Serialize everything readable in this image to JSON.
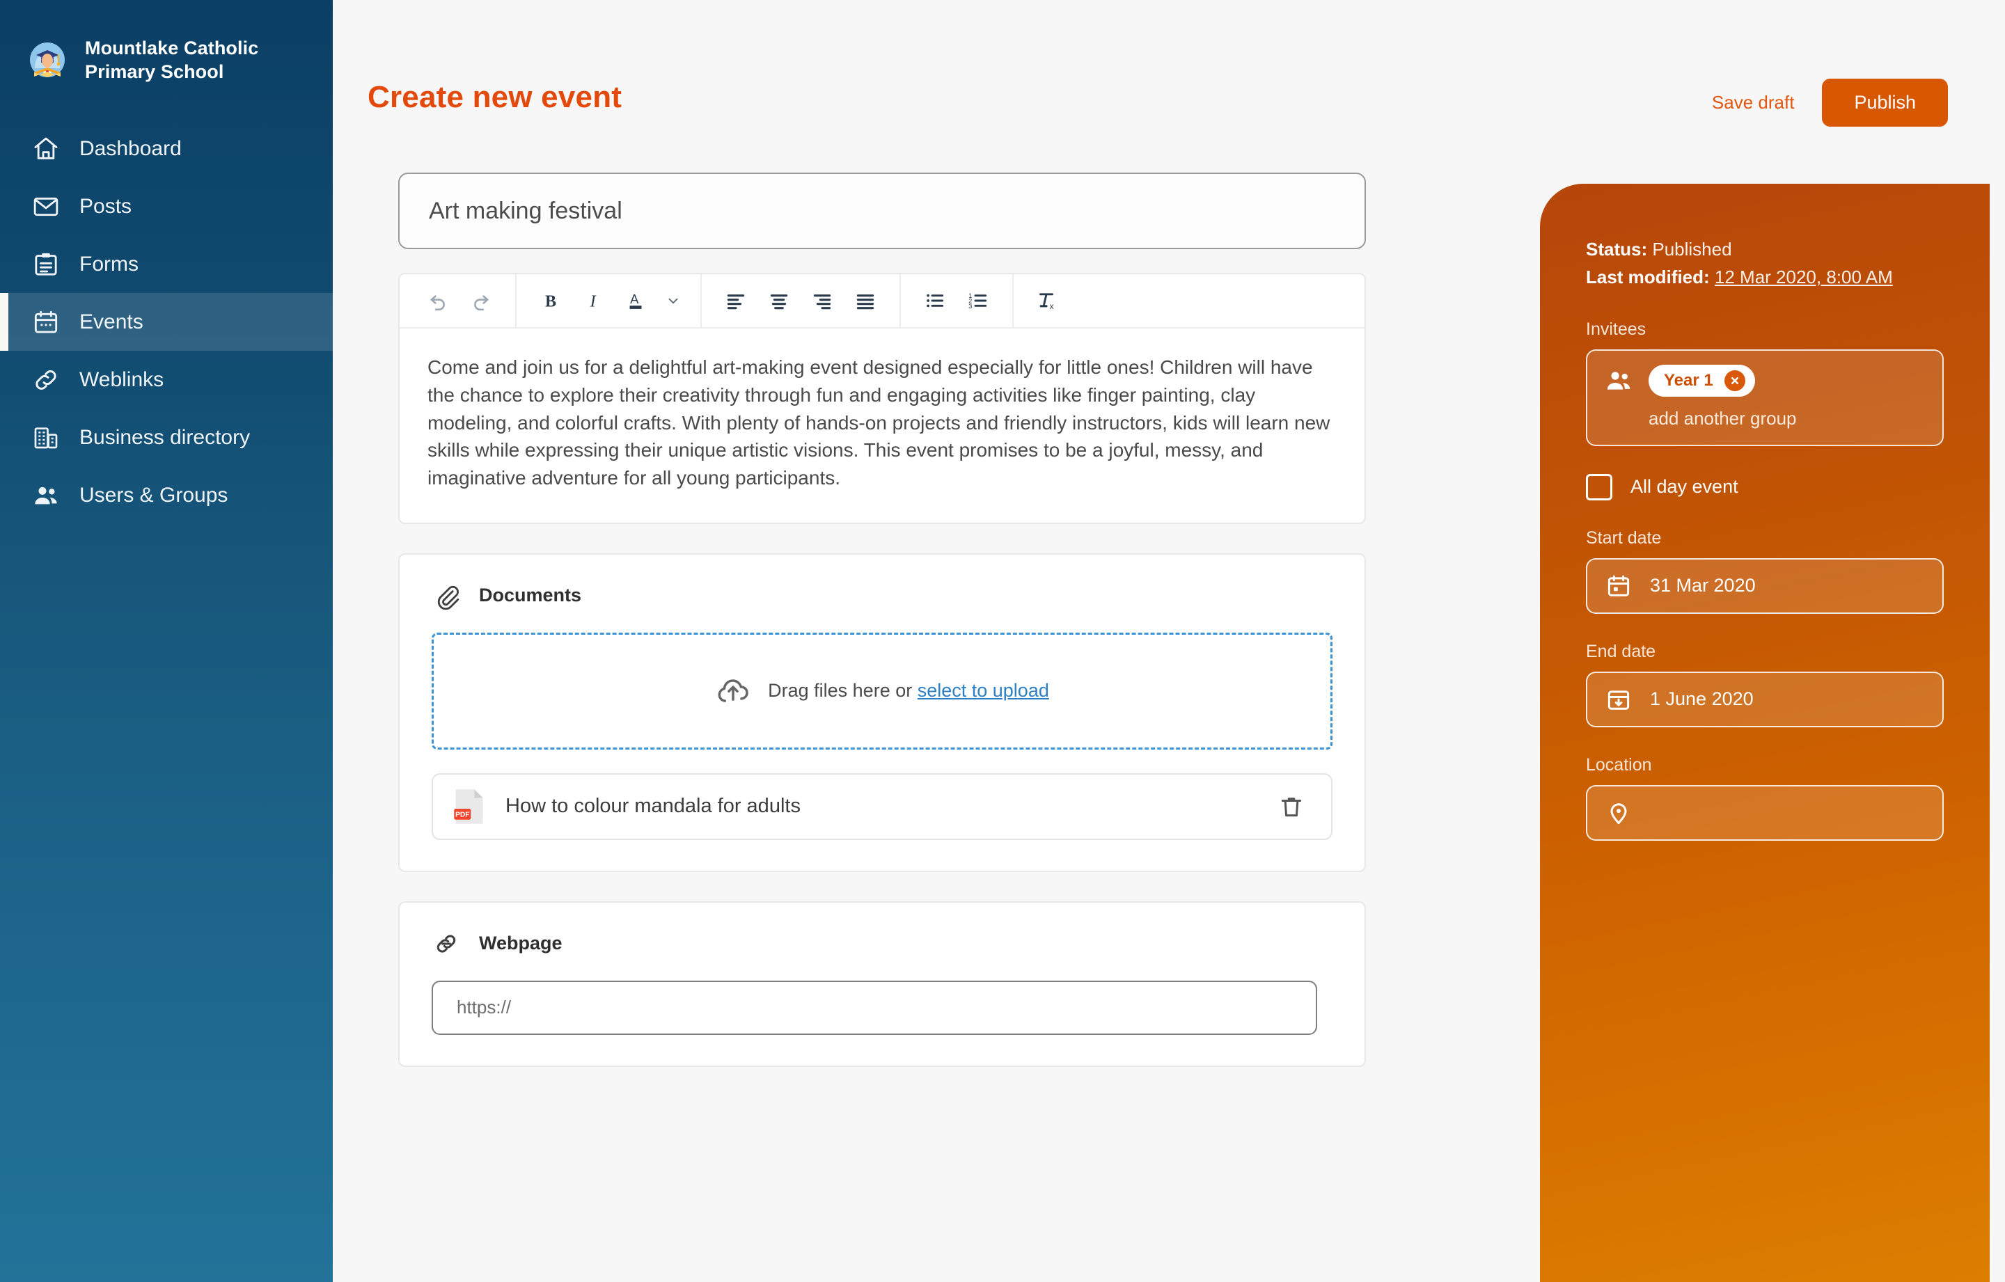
{
  "sidebar": {
    "school_name": "Mountlake Catholic\nPrimary School",
    "school_name_line1": "Mountlake Catholic",
    "school_name_line2": "Primary School",
    "items": [
      {
        "label": "Dashboard",
        "icon": "home-icon",
        "active": false
      },
      {
        "label": "Posts",
        "icon": "envelope-icon",
        "active": false
      },
      {
        "label": "Forms",
        "icon": "clipboard-icon",
        "active": false
      },
      {
        "label": "Events",
        "icon": "calendar-icon",
        "active": true
      },
      {
        "label": "Weblinks",
        "icon": "link-icon",
        "active": false
      },
      {
        "label": "Business directory",
        "icon": "building-icon",
        "active": false
      },
      {
        "label": "Users & Groups",
        "icon": "people-icon",
        "active": false
      }
    ]
  },
  "header": {
    "title": "Create new event",
    "save_draft_label": "Save draft",
    "publish_label": "Publish",
    "accent_color": "#e2490a",
    "publish_bg": "#d85703"
  },
  "event": {
    "title_value": "Art making festival",
    "title_placeholder": "Event title",
    "description": "Come and join us for a delightful art-making event designed especially for little ones! Children will have the chance to explore their creativity through fun and engaging activities like finger painting, clay modeling, and colorful crafts. With plenty of hands-on projects and friendly instructors, kids will learn new skills while expressing their unique artistic visions. This event promises to be a joyful, messy, and imaginative adventure for all young participants."
  },
  "toolbar": {
    "buttons": [
      {
        "name": "undo-icon",
        "label": "Undo"
      },
      {
        "name": "redo-icon",
        "label": "Redo"
      },
      {
        "name": "bold-icon",
        "label": "Bold"
      },
      {
        "name": "italic-icon",
        "label": "Italic"
      },
      {
        "name": "text-color-icon",
        "label": "Text colour"
      },
      {
        "name": "chevron-down-icon",
        "label": "Text colour options"
      },
      {
        "name": "align-left-icon",
        "label": "Align left"
      },
      {
        "name": "align-center-icon",
        "label": "Align center"
      },
      {
        "name": "align-right-icon",
        "label": "Align right"
      },
      {
        "name": "align-justify-icon",
        "label": "Justify"
      },
      {
        "name": "bullet-list-icon",
        "label": "Bulleted list"
      },
      {
        "name": "numbered-list-icon",
        "label": "Numbered list"
      },
      {
        "name": "clear-formatting-icon",
        "label": "Clear formatting"
      }
    ]
  },
  "documents": {
    "section_label": "Documents",
    "dropzone_text": "Drag files here or ",
    "dropzone_link": "select to upload",
    "files": [
      {
        "name": "How to colour mandala for adults",
        "type": "PDF"
      }
    ]
  },
  "webpage": {
    "section_label": "Webpage",
    "url_value": "",
    "url_placeholder": "https://"
  },
  "panel": {
    "status_label": "Status:",
    "status_value": "Published",
    "last_modified_label": "Last modified:",
    "last_modified_value": "12 Mar 2020, 8:00 AM",
    "invitees_label": "Invitees",
    "invitee_chips": [
      {
        "label": "Year 1"
      }
    ],
    "add_group_label": "add another group",
    "all_day_label": "All day event",
    "all_day_checked": false,
    "start_date_label": "Start date",
    "start_date_value": "31 Mar 2020",
    "end_date_label": "End date",
    "end_date_value": "1 June 2020",
    "location_label": "Location",
    "location_value": "",
    "gradient_from": "#b6460a",
    "gradient_to": "#dd7e01"
  }
}
